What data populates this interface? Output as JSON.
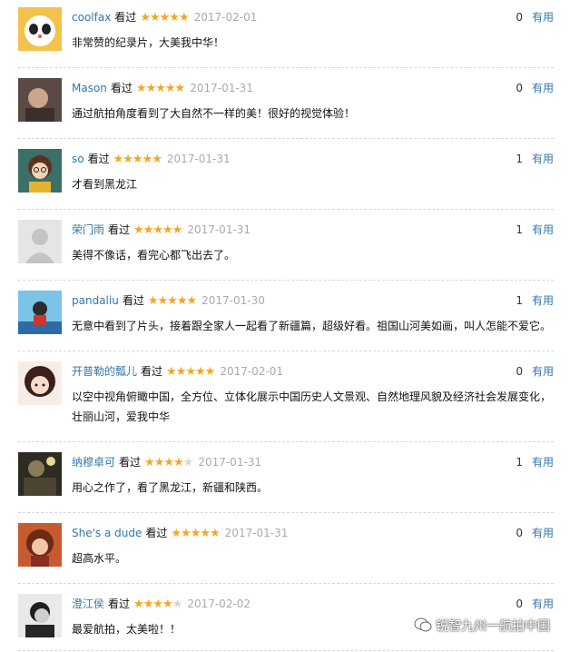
{
  "comments": [
    {
      "user": "coolfax",
      "seen": "看过",
      "stars": 5,
      "date": "2017-02-01",
      "votes": "0",
      "useful": "有用",
      "text": "非常赞的纪录片，大美我中华！"
    },
    {
      "user": "Mason",
      "seen": "看过",
      "stars": 5,
      "date": "2017-01-31",
      "votes": "0",
      "useful": "有用",
      "text": "通过航拍角度看到了大自然不一样的美！很好的视觉体验！"
    },
    {
      "user": "so",
      "seen": "看过",
      "stars": 5,
      "date": "2017-01-31",
      "votes": "1",
      "useful": "有用",
      "text": "才看到黑龙江"
    },
    {
      "user": "荣门雨",
      "seen": "看过",
      "stars": 5,
      "date": "2017-01-31",
      "votes": "1",
      "useful": "有用",
      "text": "美得不像话，看完心都飞出去了。"
    },
    {
      "user": "pandaliu",
      "seen": "看过",
      "stars": 5,
      "date": "2017-01-30",
      "votes": "1",
      "useful": "有用",
      "text": "无意中看到了片头，接着跟全家人一起看了新疆篇，超级好看。祖国山河美如画，叫人怎能不爱它。"
    },
    {
      "user": "开普勒的瓢儿",
      "seen": "看过",
      "stars": 5,
      "date": "2017-02-01",
      "votes": "0",
      "useful": "有用",
      "text": "以空中视角俯瞰中国，全方位、立体化展示中国历史人文景观、自然地理风貌及经济社会发展变化，壮丽山河，爱我中华"
    },
    {
      "user": "纳穆卓可",
      "seen": "看过",
      "stars": 4,
      "date": "2017-01-31",
      "votes": "1",
      "useful": "有用",
      "text": "用心之作了，看了黑龙江，新疆和陕西。"
    },
    {
      "user": "She's a dude",
      "seen": "看过",
      "stars": 5,
      "date": "2017-01-31",
      "votes": "0",
      "useful": "有用",
      "text": "超高水平。"
    },
    {
      "user": "澄江侯",
      "seen": "看过",
      "stars": 4,
      "date": "2017-02-02",
      "votes": "0",
      "useful": "有用",
      "text": "最爱航拍，太美啦！！"
    }
  ],
  "watermark": "锐智九州一航拍中国",
  "colors": {
    "link": "#3377aa",
    "star": "#f5a623",
    "date": "#aaaaaa"
  }
}
